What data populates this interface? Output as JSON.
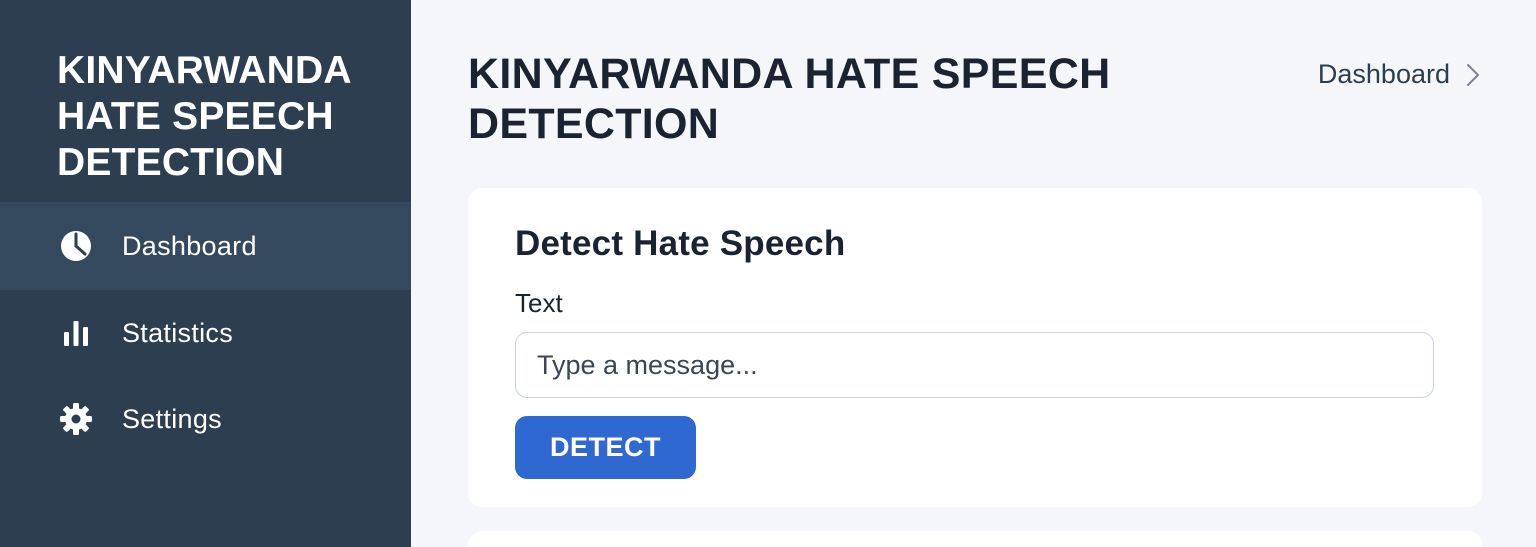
{
  "sidebar": {
    "brand": "KINYARWANDA HATE SPEECH DETECTION",
    "items": [
      {
        "label": "Dashboard",
        "icon": "dashboard-clock-icon",
        "active": true
      },
      {
        "label": "Statistics",
        "icon": "bar-chart-icon",
        "active": false
      },
      {
        "label": "Settings",
        "icon": "gear-icon",
        "active": false
      }
    ]
  },
  "header": {
    "title": "KINYARWANDA HATE SPEECH DETECTION",
    "breadcrumb": "Dashboard"
  },
  "detect_card": {
    "title": "Detect Hate Speech",
    "field_label": "Text",
    "input_placeholder": "Type a message...",
    "input_value": "",
    "button_label": "DETECT"
  },
  "colors": {
    "sidebar_bg": "#2c3e50",
    "sidebar_active_bg": "#34495e",
    "page_bg": "#f4f6f9",
    "accent": "#2f68d1"
  }
}
